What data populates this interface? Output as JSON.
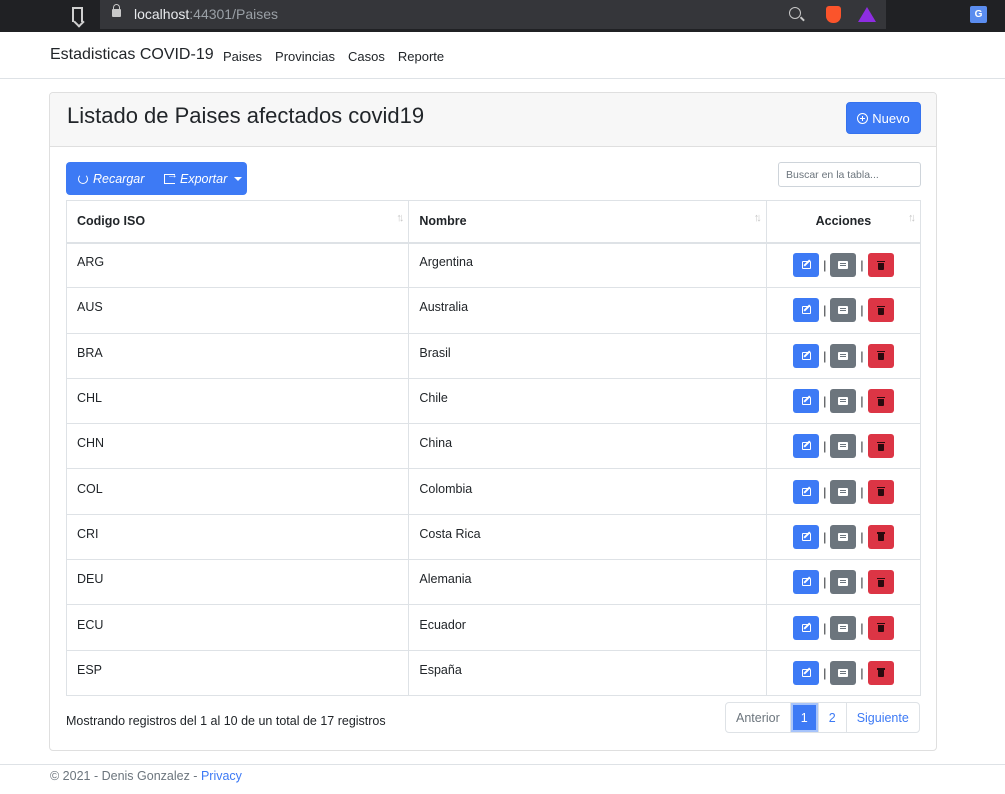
{
  "browser": {
    "url_host": "localhost",
    "url_rest": ":44301/Paises"
  },
  "navbar": {
    "brand": "Estadisticas COVID-19",
    "links": [
      "Paises",
      "Provincias",
      "Casos",
      "Reporte"
    ]
  },
  "card": {
    "title": "Listado de Paises afectados covid19",
    "new_button": "Nuevo"
  },
  "toolbar": {
    "reload_label": "Recargar",
    "export_label": "Exportar",
    "search_placeholder": "Buscar en la tabla..."
  },
  "table": {
    "headers": [
      "Codigo ISO",
      "Nombre",
      "Acciones"
    ],
    "rows": [
      {
        "iso": "ARG",
        "nombre": "Argentina"
      },
      {
        "iso": "AUS",
        "nombre": "Australia"
      },
      {
        "iso": "BRA",
        "nombre": "Brasil"
      },
      {
        "iso": "CHL",
        "nombre": "Chile"
      },
      {
        "iso": "CHN",
        "nombre": "China"
      },
      {
        "iso": "COL",
        "nombre": "Colombia"
      },
      {
        "iso": "CRI",
        "nombre": "Costa Rica"
      },
      {
        "iso": "DEU",
        "nombre": "Alemania"
      },
      {
        "iso": "ECU",
        "nombre": "Ecuador"
      },
      {
        "iso": "ESP",
        "nombre": "España"
      }
    ],
    "separator": "|"
  },
  "footer_info": "Mostrando registros del 1 al 10 de un total de 17 registros",
  "pagination": {
    "previous": "Anterior",
    "pages": [
      "1",
      "2"
    ],
    "next": "Siguiente"
  },
  "footer": {
    "copyright": "© 2021 - Denis Gonzalez - ",
    "privacy": "Privacy"
  }
}
